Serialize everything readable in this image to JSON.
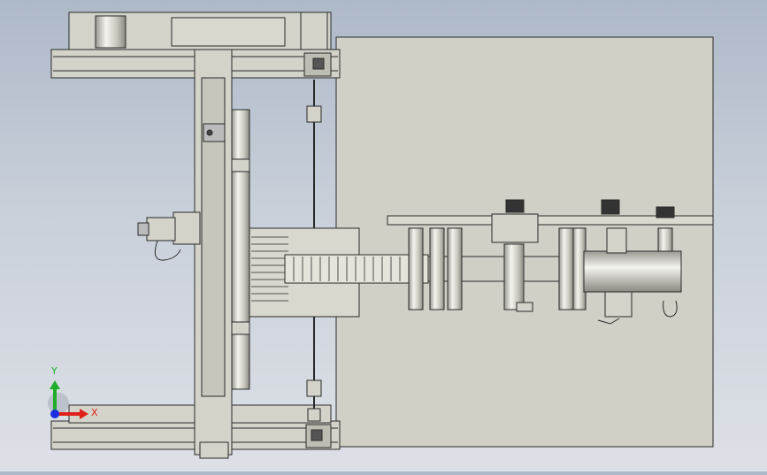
{
  "viewport": {
    "background_top": "#aeb9c8",
    "background_bottom": "#dde0e6",
    "part_color": "#d3d3c9",
    "edge_color": "#2a2a2a"
  },
  "triad": {
    "x_label": "X",
    "y_label": "Y",
    "x_color": "#e0201a",
    "y_color": "#1fae2a",
    "z_color": "#1a2fe0"
  }
}
